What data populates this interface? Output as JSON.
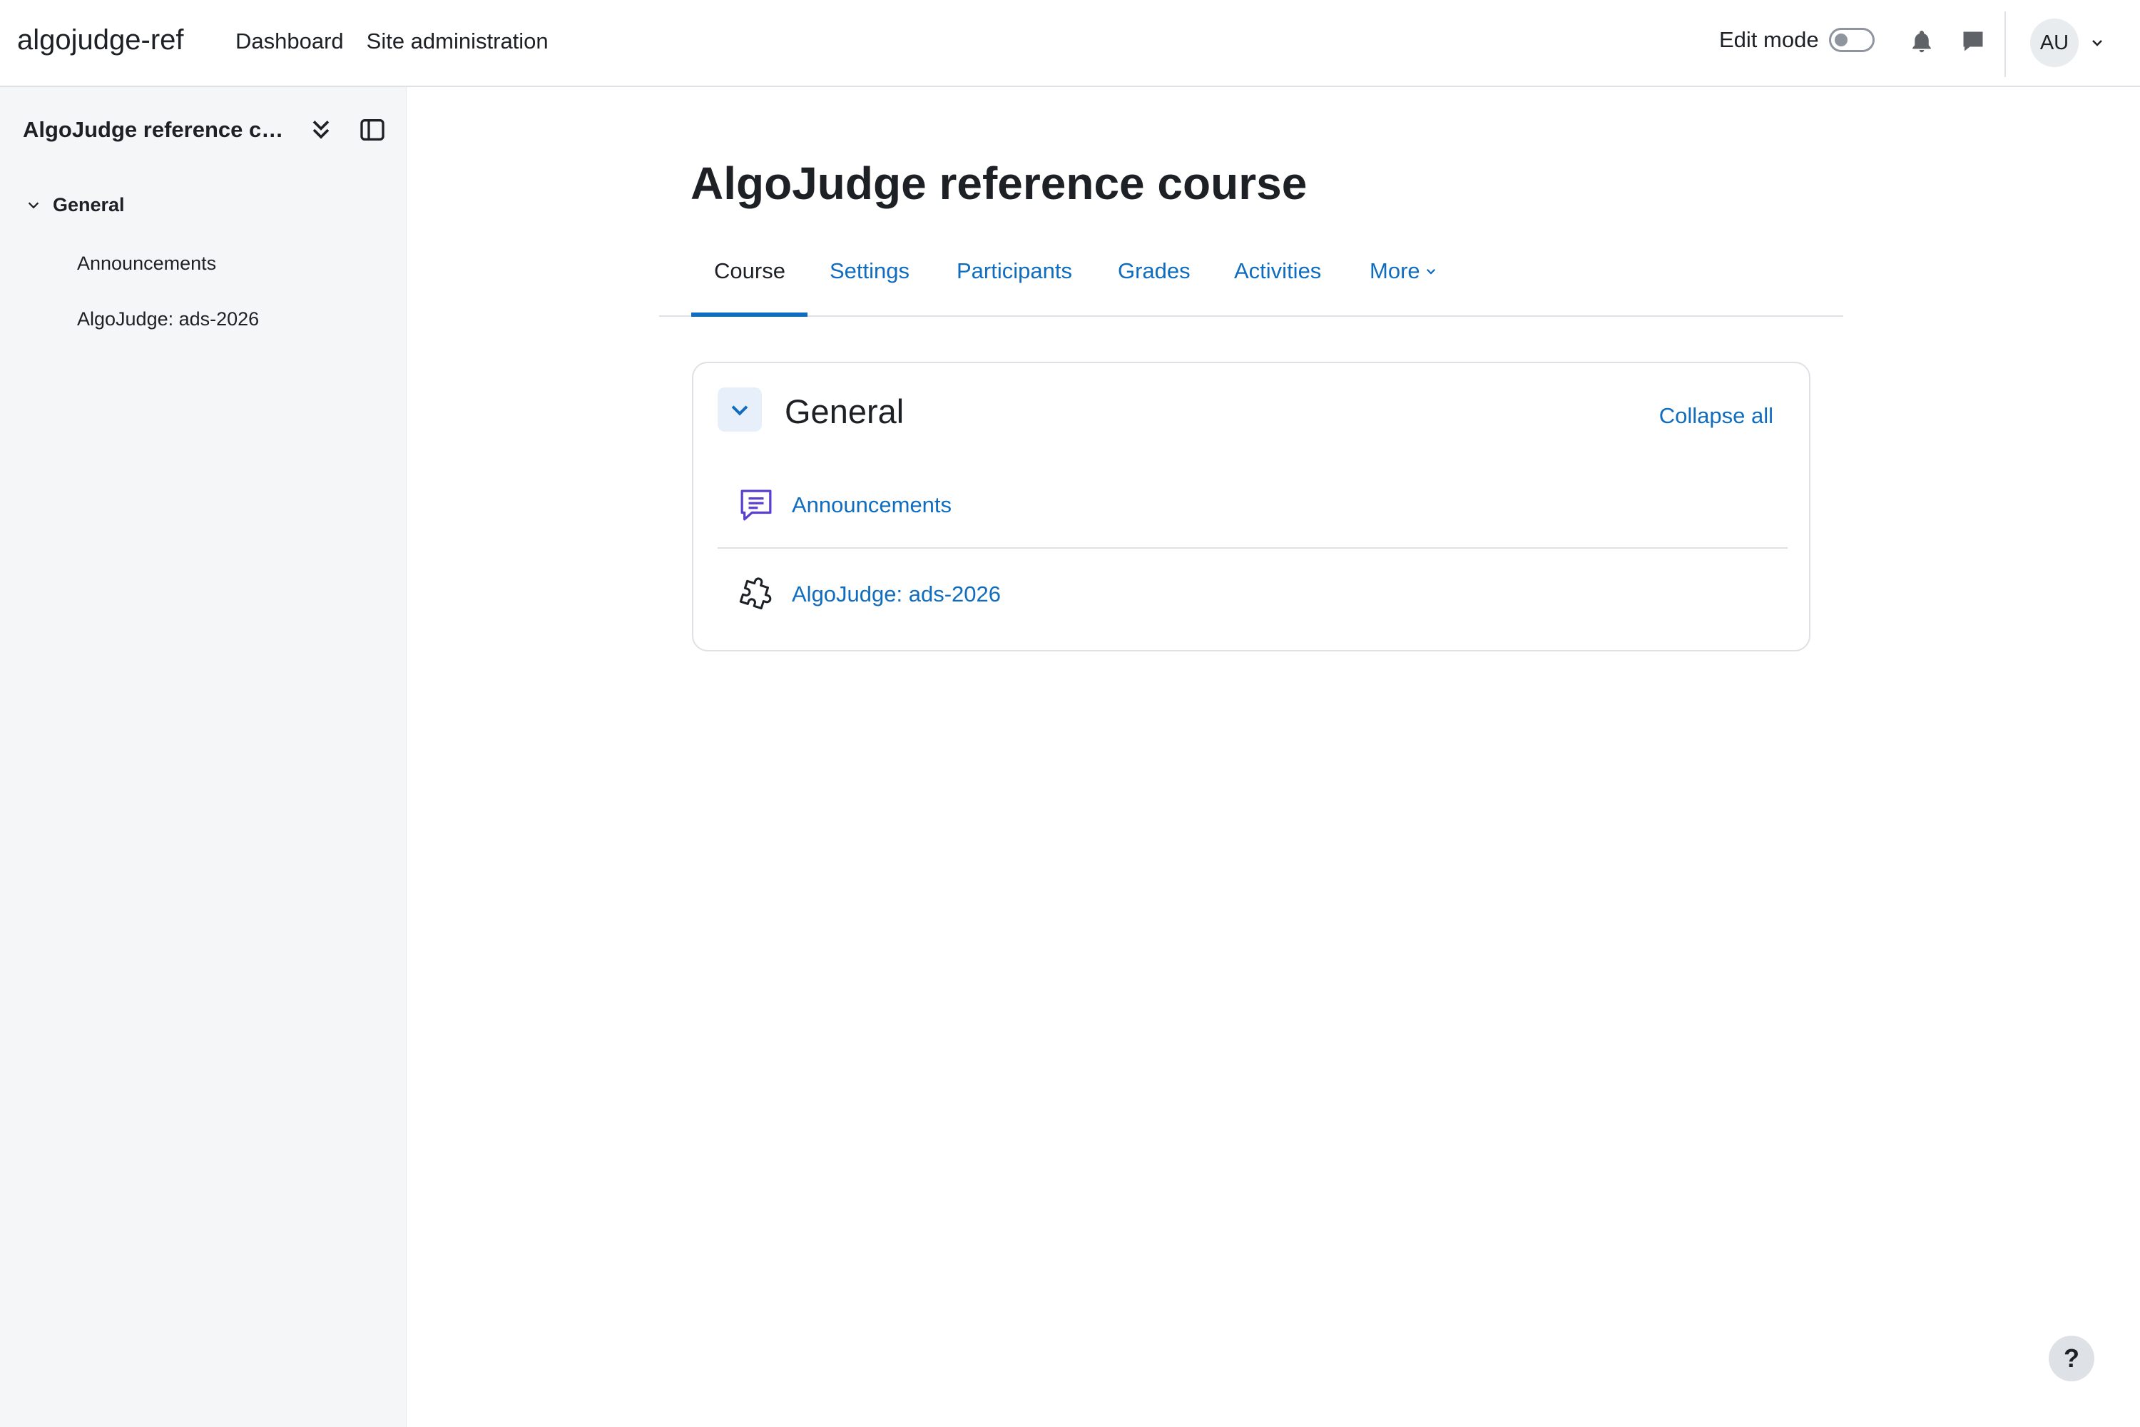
{
  "navbar": {
    "brand": "algojudge-ref",
    "links": [
      "Dashboard",
      "Site administration"
    ],
    "edit_mode_label": "Edit mode",
    "edit_mode_on": false,
    "avatar_initials": "AU"
  },
  "drawer": {
    "course_title": "AlgoJudge reference course",
    "section_label": "General",
    "items": [
      "Announcements",
      "AlgoJudge: ads-2026"
    ]
  },
  "main": {
    "page_title": "AlgoJudge reference course",
    "tabs": [
      {
        "label": "Course",
        "active": true
      },
      {
        "label": "Settings",
        "active": false
      },
      {
        "label": "Participants",
        "active": false
      },
      {
        "label": "Grades",
        "active": false
      },
      {
        "label": "Activities",
        "active": false
      },
      {
        "label": "More",
        "active": false
      }
    ],
    "section": {
      "title": "General",
      "collapse_all_label": "Collapse all",
      "activities": [
        {
          "name": "Announcements",
          "icon": "forum-icon"
        },
        {
          "name": "AlgoJudge: ads-2026",
          "icon": "puzzle-icon"
        }
      ]
    }
  },
  "help": {
    "label": "?"
  },
  "colors": {
    "link": "#0f6cbf",
    "text": "#1d2125",
    "drawer_bg": "#f5f6f8",
    "forum_icon": "#5b3fd1"
  }
}
